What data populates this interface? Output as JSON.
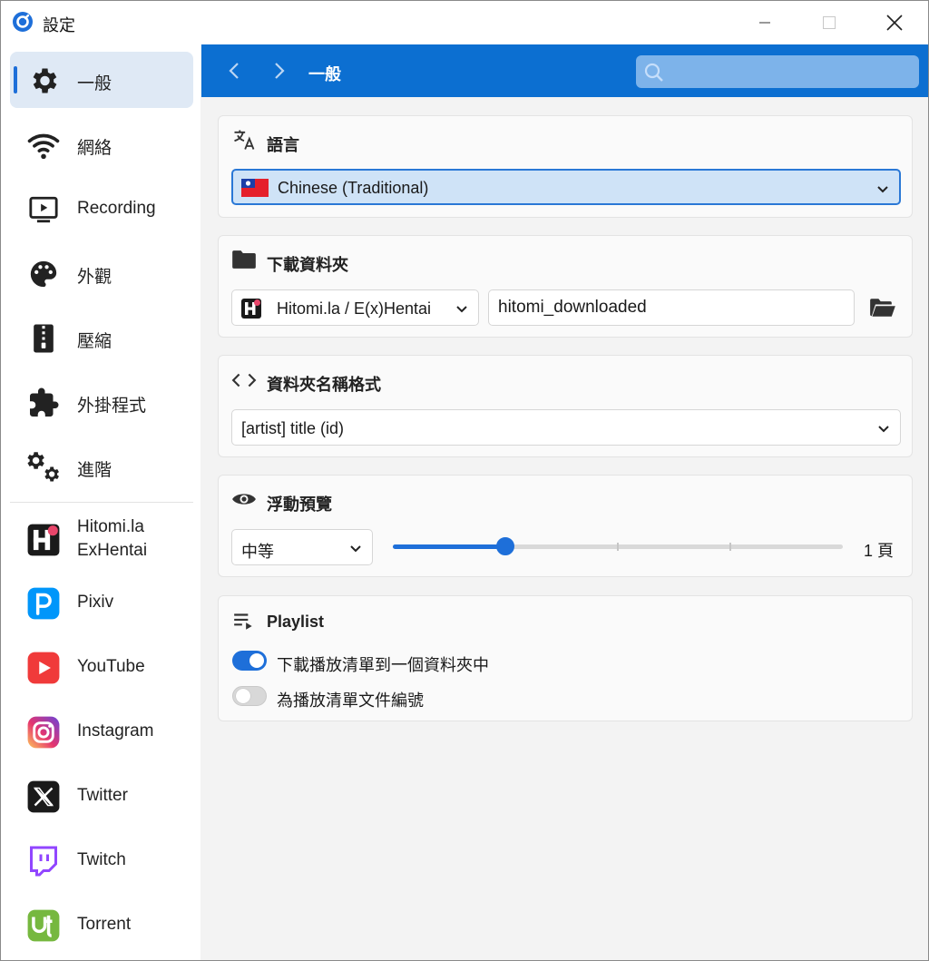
{
  "window": {
    "title": "設定"
  },
  "sidebar": {
    "items": [
      {
        "label": "一般",
        "icon": "gear-icon",
        "active": true
      },
      {
        "label": "網絡",
        "icon": "wifi-icon"
      },
      {
        "label": "Recording",
        "icon": "screen-recording-icon"
      },
      {
        "label": "外觀",
        "icon": "palette-icon"
      },
      {
        "label": "壓縮",
        "icon": "zip-archive-icon"
      },
      {
        "label": "外掛程式",
        "icon": "puzzle-icon"
      },
      {
        "label": "進階",
        "icon": "gears-icon"
      }
    ],
    "sites": [
      {
        "label_line1": "Hitomi.la",
        "label_line2": "ExHentai",
        "icon": "hitomi-logo-icon"
      },
      {
        "label": "Pixiv",
        "icon": "pixiv-logo-icon",
        "color": "#0096fa"
      },
      {
        "label": "YouTube",
        "icon": "youtube-logo-icon",
        "color": "#f03a3a"
      },
      {
        "label": "Instagram",
        "icon": "instagram-logo-icon"
      },
      {
        "label": "Twitter",
        "icon": "x-logo-icon"
      },
      {
        "label": "Twitch",
        "icon": "twitch-logo-icon",
        "color": "#9146ff"
      },
      {
        "label": "Torrent",
        "icon": "utorrent-logo-icon",
        "color": "#76b83f"
      }
    ]
  },
  "header": {
    "title": "一般",
    "search_value": ""
  },
  "language": {
    "title": "語言",
    "selected": "Chinese (Traditional)"
  },
  "download_folder": {
    "title": "下載資料夾",
    "site_selected": "Hitomi.la / E(x)Hentai",
    "folder_value": "hitomi_downloaded"
  },
  "folder_name_format": {
    "title": "資料夾名稱格式",
    "selected": "[artist] title (id)"
  },
  "hover_preview": {
    "title": "浮動預覽",
    "size_selected": "中等",
    "pages_value": 1,
    "pages_max": 4,
    "readout": "1 頁"
  },
  "playlist": {
    "title": "Playlist",
    "option1": {
      "label": "下載播放清單到一個資料夾中",
      "on": true
    },
    "option2": {
      "label": "為播放清單文件編號",
      "on": false
    }
  },
  "colors": {
    "accent": "#1e6fd9",
    "header_bg": "#0c6fd1"
  }
}
